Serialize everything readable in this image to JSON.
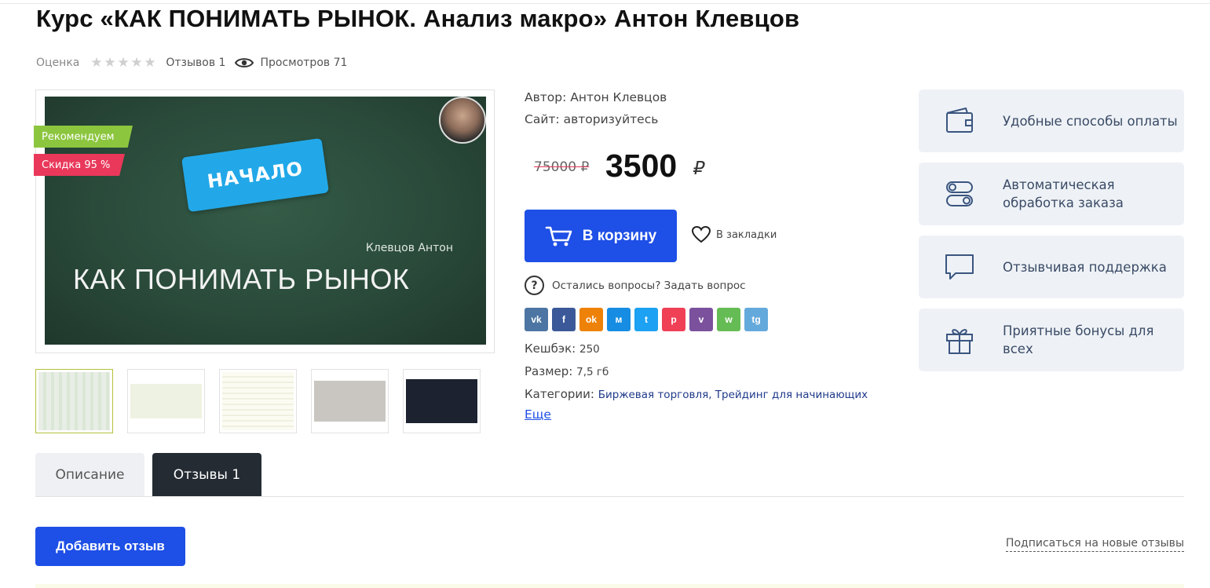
{
  "product": {
    "title": "Курс «КАК ПОНИМАТЬ РЫНОК. Анализ макро» Антон Клевцов",
    "rating_label": "Оценка",
    "reviews_count_text": "Отзывов 1",
    "views_text": "Просмотров 71"
  },
  "image": {
    "badge_recommended": "Рекомендуем",
    "badge_discount": "Скидка 95 %",
    "board_tag": "НАЧАЛО",
    "board_author": "Клевцов Антон",
    "board_title": "КАК ПОНИМАТЬ РЫНОК"
  },
  "info": {
    "author_label": "Автор:",
    "author_value": "Антон Клевцов",
    "site_label": "Сайт:",
    "site_value": "авторизуйтесь",
    "old_price": "75000 ₽",
    "new_price": "3500",
    "currency": "₽",
    "cart_label": "В корзину",
    "bookmark_label": "В закладки",
    "question_text": "Остались вопросы? Задать вопрос",
    "cashback_label": "Кешбэк:",
    "cashback_value": "250",
    "size_label": "Размер:",
    "size_value": "7,5 гб",
    "categories_label": "Категории:",
    "categories_value": "Биржевая торговля, Трейдинг для начинающих",
    "more_link": "Еще"
  },
  "socials": [
    {
      "name": "vk",
      "glyph": "vk",
      "color": "#4c75a3"
    },
    {
      "name": "facebook",
      "glyph": "f",
      "color": "#3b5998"
    },
    {
      "name": "odnoklassniki",
      "glyph": "ok",
      "color": "#ee8208"
    },
    {
      "name": "moimir",
      "glyph": "м",
      "color": "#168de2"
    },
    {
      "name": "twitter",
      "glyph": "t",
      "color": "#1da1f2"
    },
    {
      "name": "pocket",
      "glyph": "p",
      "color": "#ef4056"
    },
    {
      "name": "viber",
      "glyph": "v",
      "color": "#7b519d"
    },
    {
      "name": "whatsapp",
      "glyph": "w",
      "color": "#65bc54"
    },
    {
      "name": "telegram",
      "glyph": "tg",
      "color": "#64a9dc"
    }
  ],
  "features": [
    {
      "text": "Удобные способы оплаты",
      "icon": "wallet-icon"
    },
    {
      "text": "Автоматическая обработка заказа",
      "icon": "toggles-icon"
    },
    {
      "text": "Отзывчивая поддержка",
      "icon": "chat-icon"
    },
    {
      "text": "Приятные бонусы для всех",
      "icon": "gift-icon"
    }
  ],
  "tabs": [
    {
      "label": "Описание",
      "active": false
    },
    {
      "label": "Отзывы 1",
      "active": true
    }
  ],
  "reviews": {
    "add_button": "Добавить отзыв",
    "subscribe_link": "Подписаться на новые отзывы"
  },
  "colors": {
    "accent": "#1e4fe6",
    "recommended": "#8cc63f",
    "discount": "#e9385a",
    "feature_bg": "#eef2f6",
    "active_tab": "#242b33"
  }
}
